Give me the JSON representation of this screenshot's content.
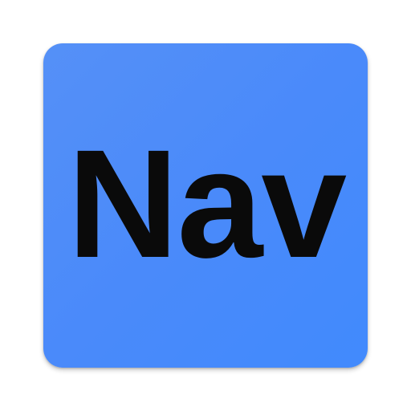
{
  "icon": {
    "label": "Nav",
    "background_color": "#4a8afa",
    "text_color": "#0a0a0a"
  }
}
